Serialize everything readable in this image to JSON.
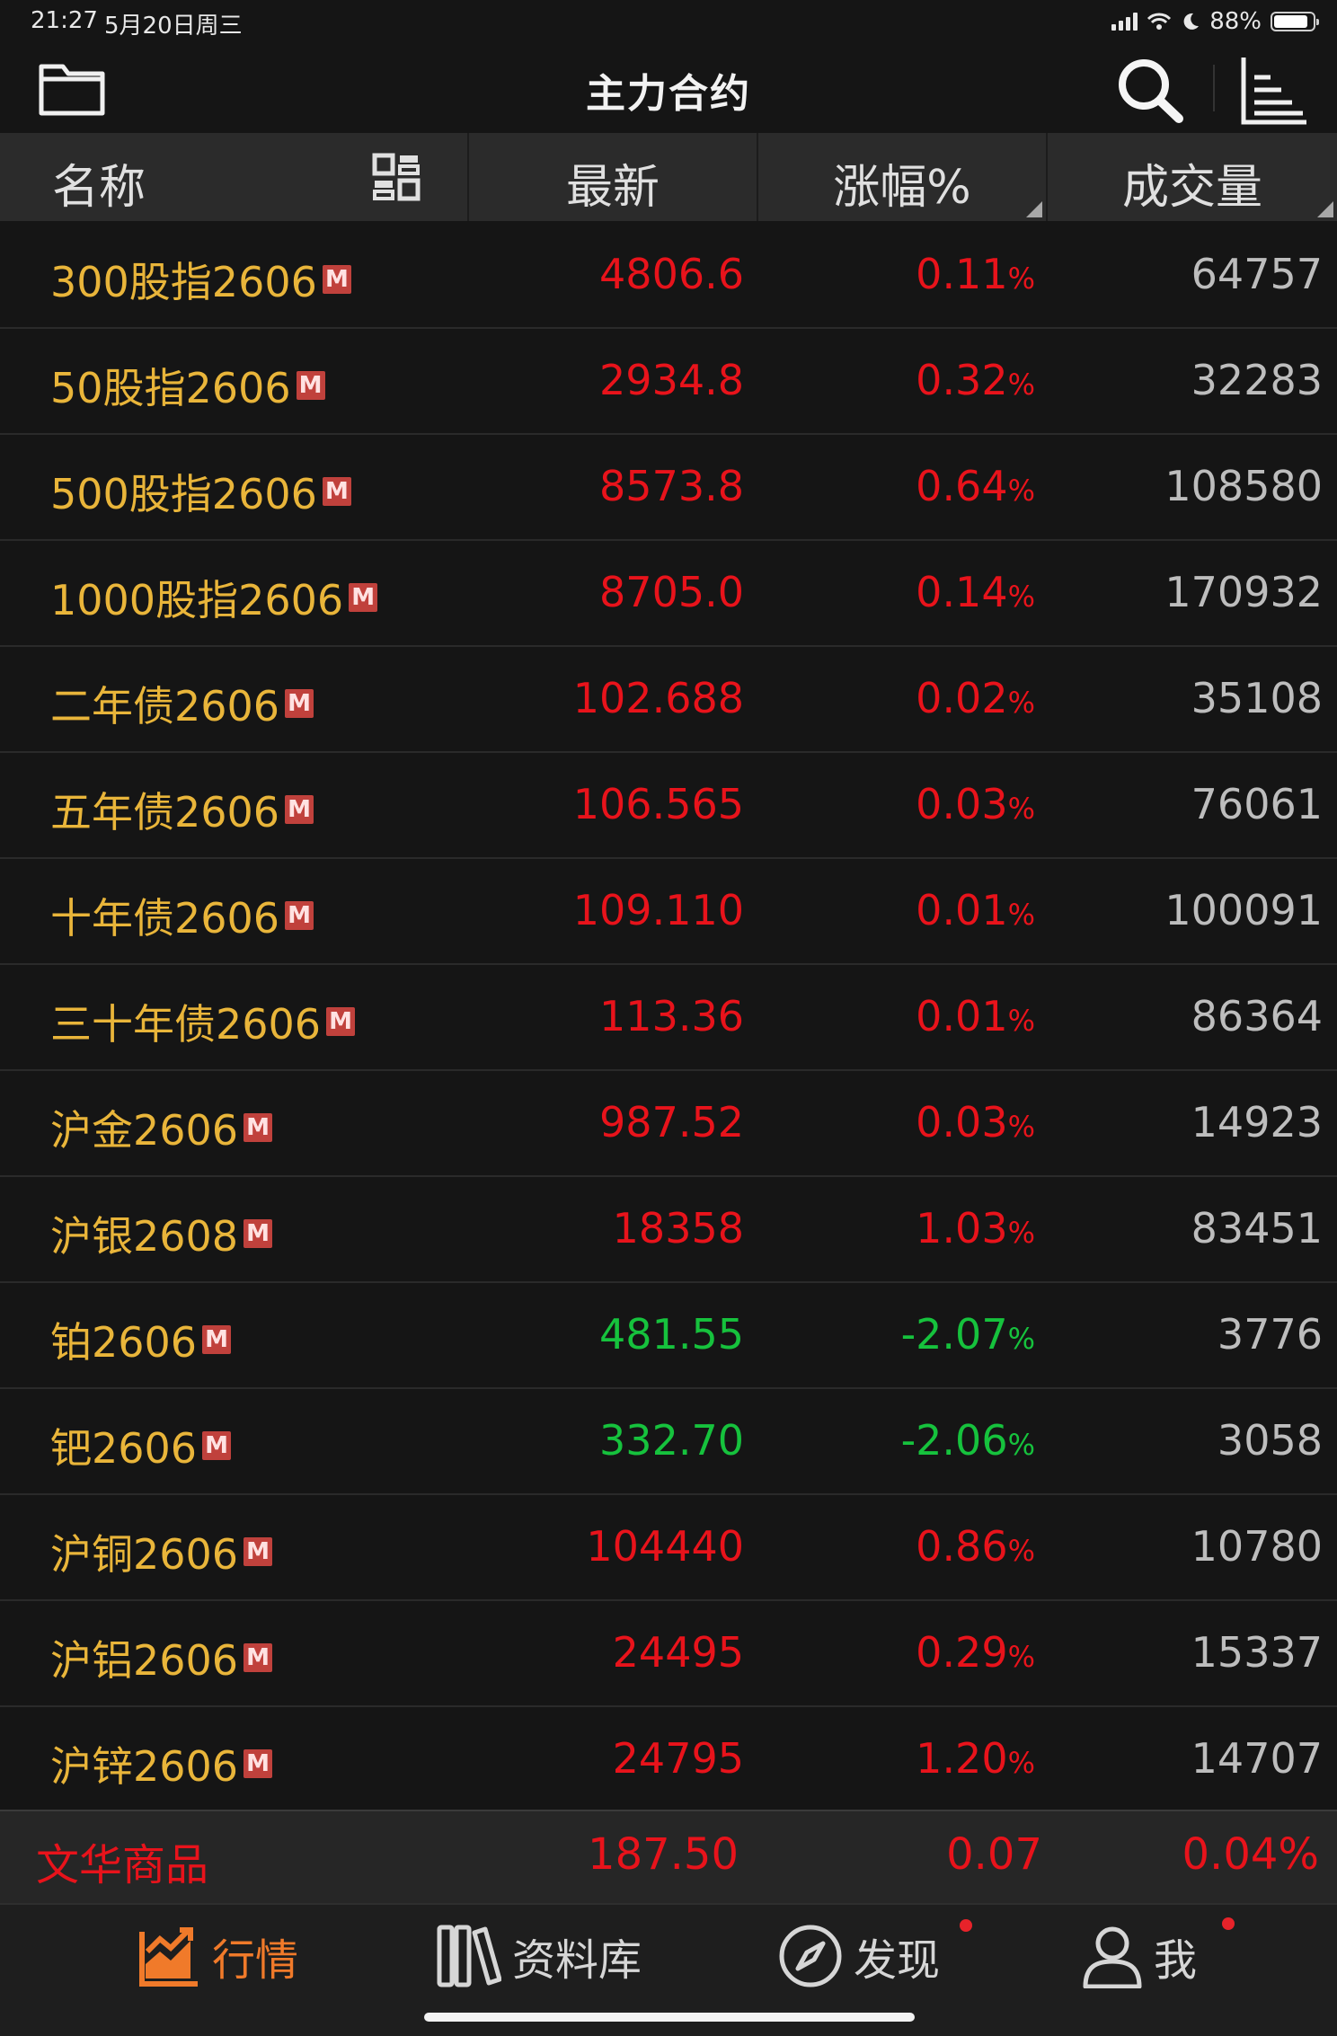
{
  "status_bar": {
    "time": "21:27",
    "date": "5月20日周三",
    "battery": "88%",
    "battery_level": 0.88
  },
  "nav": {
    "title": "主力合约",
    "icons": [
      "folder-icon",
      "search-icon",
      "sort-list-icon"
    ]
  },
  "table": {
    "columns": {
      "name": "名称",
      "last": "最新",
      "change_pct": "涨幅%",
      "volume": "成交量"
    },
    "badge": "M",
    "rows": [
      {
        "name": "300股指2606",
        "last": "4806.6",
        "chg": "0.11",
        "unit": "%",
        "vol": "64757",
        "dir": "up"
      },
      {
        "name": "50股指2606",
        "last": "2934.8",
        "chg": "0.32",
        "unit": "%",
        "vol": "32283",
        "dir": "up"
      },
      {
        "name": "500股指2606",
        "last": "8573.8",
        "chg": "0.64",
        "unit": "%",
        "vol": "108580",
        "dir": "up"
      },
      {
        "name": "1000股指2606",
        "last": "8705.0",
        "chg": "0.14",
        "unit": "%",
        "vol": "170932",
        "dir": "up"
      },
      {
        "name": "二年债2606",
        "last": "102.688",
        "chg": "0.02",
        "unit": "%",
        "vol": "35108",
        "dir": "up"
      },
      {
        "name": "五年债2606",
        "last": "106.565",
        "chg": "0.03",
        "unit": "%",
        "vol": "76061",
        "dir": "up"
      },
      {
        "name": "十年债2606",
        "last": "109.110",
        "chg": "0.01",
        "unit": "%",
        "vol": "100091",
        "dir": "up"
      },
      {
        "name": "三十年债2606",
        "last": "113.36",
        "chg": "0.01",
        "unit": "%",
        "vol": "86364",
        "dir": "up"
      },
      {
        "name": "沪金2606",
        "last": "987.52",
        "chg": "0.03",
        "unit": "%",
        "vol": "14923",
        "dir": "up"
      },
      {
        "name": "沪银2608",
        "last": "18358",
        "chg": "1.03",
        "unit": "%",
        "vol": "83451",
        "dir": "up"
      },
      {
        "name": "铂2606",
        "last": "481.55",
        "chg": "-2.07",
        "unit": "%",
        "vol": "3776",
        "dir": "down"
      },
      {
        "name": "钯2606",
        "last": "332.70",
        "chg": "-2.06",
        "unit": "%",
        "vol": "3058",
        "dir": "down"
      },
      {
        "name": "沪铜2606",
        "last": "104440",
        "chg": "0.86",
        "unit": "%",
        "vol": "10780",
        "dir": "up"
      },
      {
        "name": "沪铝2606",
        "last": "24495",
        "chg": "0.29",
        "unit": "%",
        "vol": "15337",
        "dir": "up"
      },
      {
        "name": "沪锌2606",
        "last": "24795",
        "chg": "1.20",
        "unit": "%",
        "vol": "14707",
        "dir": "up"
      }
    ]
  },
  "index_bar": {
    "name": "文华商品",
    "price": "187.50",
    "change": "0.07",
    "pct": "0.04%"
  },
  "tabs": {
    "quotes": "行情",
    "library": "资料库",
    "discover": "发现",
    "me": "我"
  },
  "colors": {
    "up": "#e8131b",
    "down": "#16c23d",
    "name": "#e9b53a",
    "accent": "#f07a2a",
    "badge": "#c0413c"
  }
}
